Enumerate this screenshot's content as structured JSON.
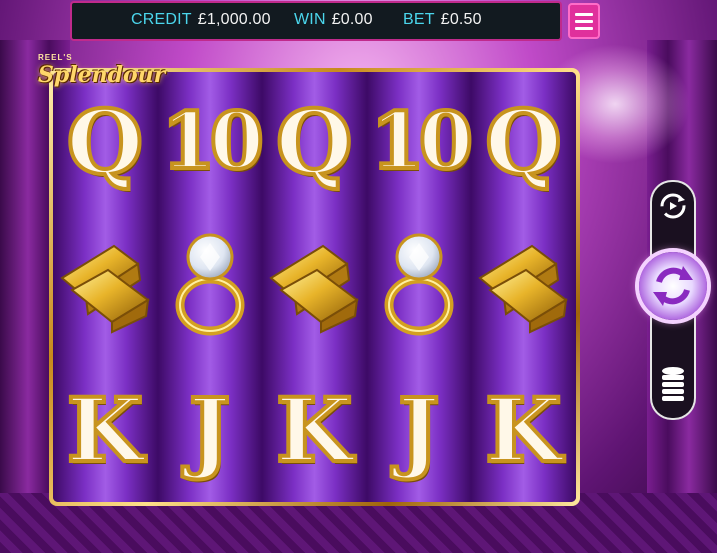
{
  "topbar": {
    "credit_label": "CREDIT",
    "credit_value": "£1,000.00",
    "win_label": "WIN",
    "win_value": "£0.00",
    "bet_label": "BET",
    "bet_value": "£0.50"
  },
  "logo": {
    "small": "REEL'S",
    "main": "Splendour"
  },
  "reels": [
    [
      "Q",
      "gold-bars",
      "K"
    ],
    [
      "10",
      "diamond-ring",
      "J"
    ],
    [
      "Q",
      "gold-bars",
      "K"
    ],
    [
      "10",
      "diamond-ring",
      "J"
    ],
    [
      "Q",
      "gold-bars",
      "K"
    ]
  ],
  "colors": {
    "accent": "#e0309c",
    "label": "#4bd6ec",
    "gold": "#c8941e",
    "reel": "#7b2fc4"
  },
  "icons": {
    "menu": "hamburger-icon",
    "autoplay": "autoplay-icon",
    "spin": "spin-icon",
    "bet": "coin-stack-icon"
  }
}
